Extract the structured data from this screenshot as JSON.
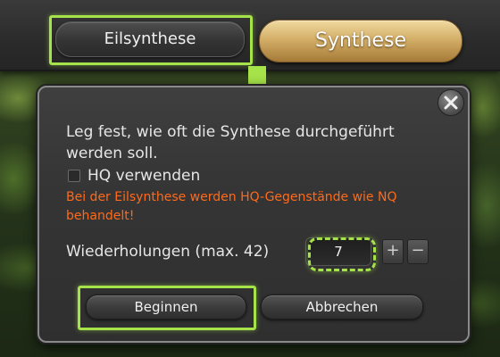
{
  "mode_buttons": {
    "quick_synthesis": "Eilsynthese",
    "synthesis": "Synthese"
  },
  "dialog": {
    "description": "Leg fest, wie oft die Synthese durchgeführt werden soll.",
    "hq_label": "HQ verwenden",
    "hq_checked": false,
    "warning": "Bei der Eilsynthese werden HQ-Gegenstände wie NQ behandelt!",
    "repetitions_label": "Wiederholungen (max. 42)",
    "repetitions_value": "7",
    "plus_label": "+",
    "minus_label": "−",
    "begin_label": "Beginnen",
    "cancel_label": "Abbrechen"
  },
  "colors": {
    "highlight": "#a6e24a",
    "warning_text": "#ff6a1a",
    "gold_button": "#d4af68"
  },
  "icons": {
    "close": "close-x-icon",
    "arrow": "arrow-down-icon"
  }
}
